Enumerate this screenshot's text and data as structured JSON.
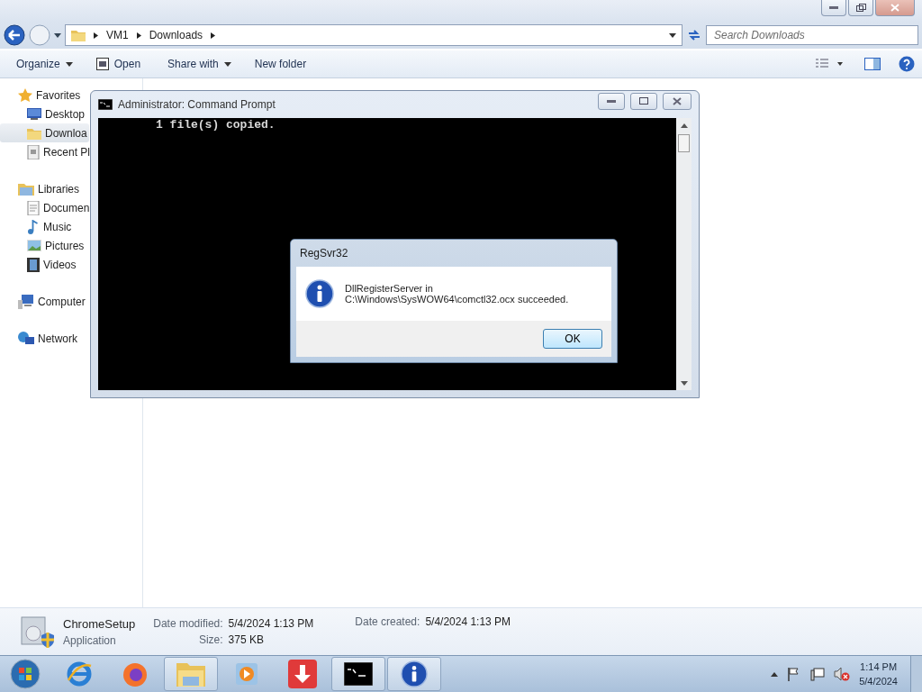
{
  "address_bar": {
    "breadcrumbs": [
      "VM1",
      "Downloads"
    ]
  },
  "search": {
    "placeholder": "Search Downloads"
  },
  "toolbar": {
    "items": [
      {
        "label": "Organize",
        "kind": "menu"
      },
      {
        "label": "Open",
        "kind": "open"
      },
      {
        "label": "Share with",
        "kind": "menu"
      },
      {
        "label": "New folder",
        "kind": "plain"
      }
    ]
  },
  "sidebar": {
    "groups": [
      {
        "label": "Favorites",
        "selected": false,
        "children": [
          {
            "label": "Desktop",
            "selected": false
          },
          {
            "label": "Downloa",
            "selected": true
          },
          {
            "label": "Recent Pl",
            "selected": false
          }
        ]
      },
      {
        "label": "Libraries",
        "selected": false,
        "children": [
          {
            "label": "Documen",
            "selected": false
          },
          {
            "label": "Music",
            "selected": false
          },
          {
            "label": "Pictures",
            "selected": false
          },
          {
            "label": "Videos",
            "selected": false
          }
        ]
      },
      {
        "label": "Computer",
        "selected": false
      },
      {
        "label": "Network",
        "selected": false
      }
    ]
  },
  "details_pane": {
    "name": "ChromeSetup",
    "type": "Application",
    "fields": [
      {
        "label": "Date modified:",
        "value": "5/4/2024 1:13 PM"
      },
      {
        "label": "Size:",
        "value": "375 KB"
      },
      {
        "label": "Date created:",
        "value": "5/4/2024 1:13 PM"
      }
    ]
  },
  "console_window": {
    "title": "Administrator:  Command Prompt",
    "output": "1 file(s) copied."
  },
  "dialog": {
    "title": "RegSvr32",
    "message_lines": [
      "DllRegisterServer in",
      "C:\\Windows\\SysWOW64\\comctl32.ocx succeeded."
    ],
    "buttons": [
      {
        "label": "OK"
      }
    ]
  },
  "taskbar": {
    "apps": [
      {
        "open": false
      },
      {
        "open": false
      },
      {
        "open": true
      },
      {
        "open": false
      },
      {
        "open": false
      },
      {
        "open": true
      },
      {
        "open": true
      }
    ],
    "clock": {
      "time": "1:14 PM",
      "date": "5/4/2024"
    }
  }
}
